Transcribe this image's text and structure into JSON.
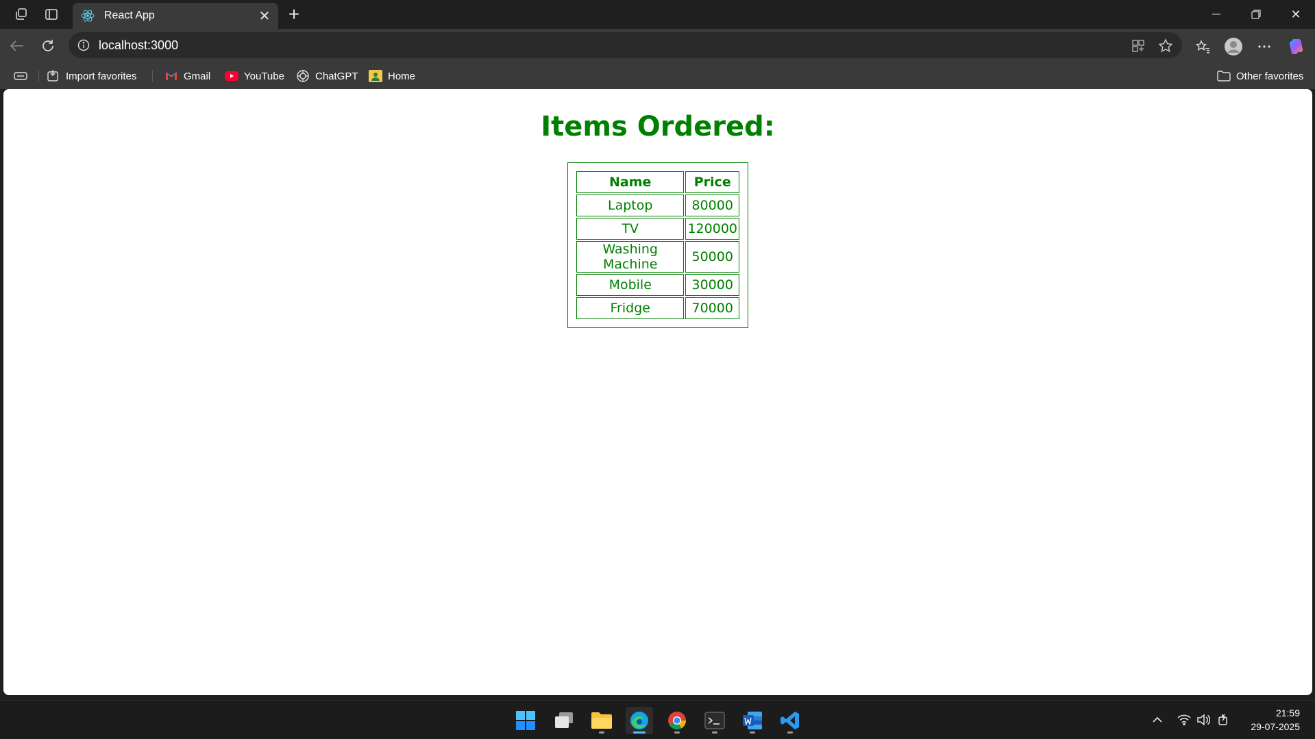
{
  "browser": {
    "tab_title": "React App",
    "url": "localhost:3000",
    "favorites": [
      {
        "label": "Import favorites",
        "icon": "import-icon"
      },
      {
        "label": "Gmail",
        "icon": "gmail-icon"
      },
      {
        "label": "YouTube",
        "icon": "youtube-icon"
      },
      {
        "label": "ChatGPT",
        "icon": "chatgpt-icon"
      },
      {
        "label": "Home",
        "icon": "home-icon"
      }
    ],
    "other_favorites": "Other favorites"
  },
  "page": {
    "title": "Items Ordered:",
    "columns": [
      "Name",
      "Price"
    ],
    "rows": [
      {
        "name": "Laptop",
        "price": "80000"
      },
      {
        "name": "TV",
        "price": "120000"
      },
      {
        "name": "Washing Machine",
        "price": "50000"
      },
      {
        "name": "Mobile",
        "price": "30000"
      },
      {
        "name": "Fridge",
        "price": "70000"
      }
    ],
    "accent_color": "#008000"
  },
  "taskbar": {
    "apps": [
      "start-icon",
      "task-view-icon",
      "file-explorer-icon",
      "edge-icon",
      "chrome-icon",
      "terminal-icon",
      "word-icon",
      "vscode-icon"
    ],
    "time": "21:59",
    "date": "29-07-2025"
  }
}
